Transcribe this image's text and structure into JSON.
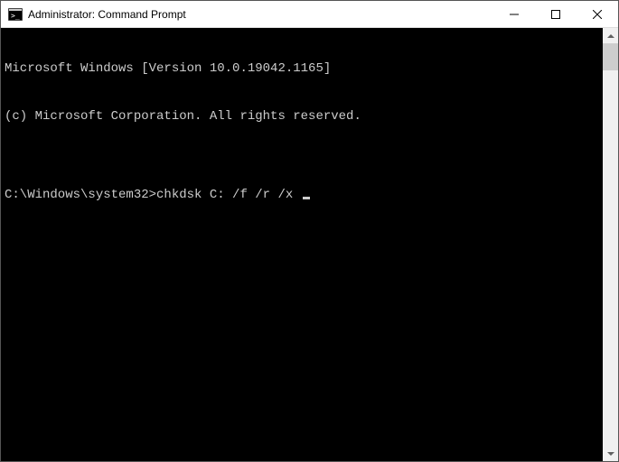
{
  "titlebar": {
    "title": "Administrator: Command Prompt"
  },
  "terminal": {
    "line1": "Microsoft Windows [Version 10.0.19042.1165]",
    "line2": "(c) Microsoft Corporation. All rights reserved.",
    "blank": "",
    "prompt": "C:\\Windows\\system32>",
    "command": "chkdsk C: /f /r /x"
  }
}
